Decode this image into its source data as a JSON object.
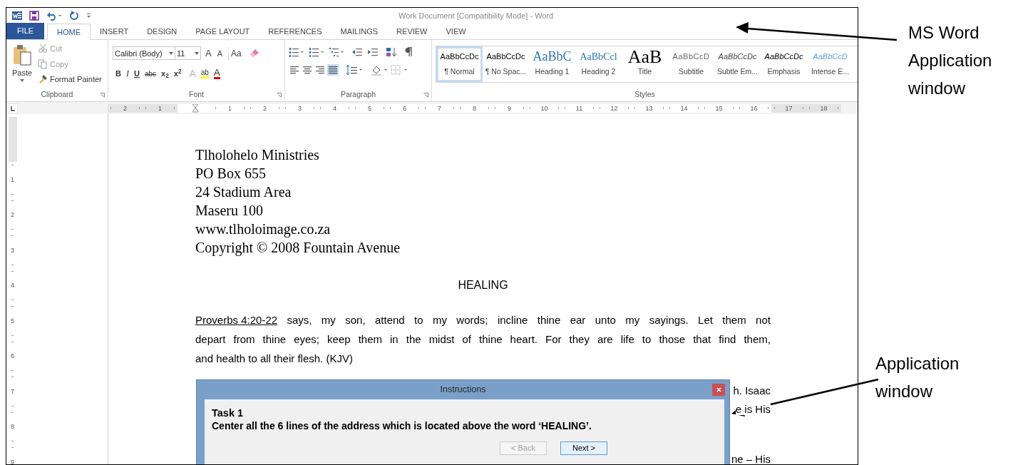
{
  "window": {
    "title": "Work Document [Compatibility Mode] - Word"
  },
  "tabs": [
    {
      "label": "FILE",
      "kind": "file",
      "selected": false
    },
    {
      "label": "HOME",
      "kind": "tab",
      "selected": true
    },
    {
      "label": "INSERT",
      "kind": "tab",
      "selected": false
    },
    {
      "label": "DESIGN",
      "kind": "tab",
      "selected": false
    },
    {
      "label": "PAGE LAYOUT",
      "kind": "tab",
      "selected": false
    },
    {
      "label": "REFERENCES",
      "kind": "tab",
      "selected": false
    },
    {
      "label": "MAILINGS",
      "kind": "tab",
      "selected": false
    },
    {
      "label": "REVIEW",
      "kind": "tab",
      "selected": false
    },
    {
      "label": "VIEW",
      "kind": "tab",
      "selected": false
    }
  ],
  "clipboard": {
    "label": "Clipboard",
    "paste": "Paste",
    "items": [
      {
        "label": "Cut",
        "kind": "cut",
        "disabled": true
      },
      {
        "label": "Copy",
        "kind": "copy",
        "disabled": true
      },
      {
        "label": "Format Painter",
        "kind": "painter",
        "disabled": false
      }
    ]
  },
  "font": {
    "label": "Font",
    "font_name": "Calibri (Body)",
    "font_size": "11",
    "row1": [
      {
        "label": "A",
        "kind": "grow"
      },
      {
        "label": "A",
        "kind": "shrink"
      },
      {
        "label": "Aa",
        "kind": "case"
      }
    ],
    "row2": [
      {
        "label": "B",
        "kind": "bold"
      },
      {
        "label": "I",
        "kind": "italic"
      },
      {
        "label": "U",
        "kind": "underline"
      },
      {
        "label": "abc",
        "kind": "strike"
      },
      {
        "label": "x$_{2}$",
        "kind": "sub"
      },
      {
        "label": "x$^{2}$",
        "kind": "sup"
      },
      {
        "label": "A",
        "kind": "effects"
      },
      {
        "label": "ab",
        "kind": "highlight"
      },
      {
        "label": "A",
        "kind": "color"
      }
    ]
  },
  "paragraph": {
    "label": "Paragraph",
    "alignments": [
      {
        "kind": "left",
        "selected": false
      },
      {
        "kind": "center",
        "selected": false
      },
      {
        "kind": "right",
        "selected": false
      },
      {
        "kind": "justify",
        "selected": true
      }
    ]
  },
  "styles": {
    "label": "Styles",
    "items": [
      {
        "preview": "AaBbCcDc",
        "label": "¶ Normal",
        "kind": "normal",
        "selected": true
      },
      {
        "preview": "AaBbCcDc",
        "label": "¶ No Spac...",
        "kind": "normal",
        "selected": false
      },
      {
        "preview": "AaBbC",
        "label": "Heading 1",
        "kind": "heading1",
        "selected": false
      },
      {
        "preview": "AaBbCcl",
        "label": "Heading 2",
        "kind": "heading2",
        "selected": false
      },
      {
        "preview": "AaB",
        "label": "Title",
        "kind": "title",
        "selected": false
      },
      {
        "preview": "AaBbCcD",
        "label": "Subtitle",
        "kind": "subtitle",
        "selected": false
      },
      {
        "preview": "AaBbCcDc",
        "label": "Subtle Em...",
        "kind": "subtle",
        "selected": false
      },
      {
        "preview": "AaBbCcDc",
        "label": "Emphasis",
        "kind": "emphasis",
        "selected": false
      },
      {
        "preview": "AaBbCcD",
        "label": "Intense E...",
        "kind": "intense",
        "selected": false
      }
    ]
  },
  "ruler": {
    "horizontal": [
      "2",
      "1",
      "1",
      "2",
      "3",
      "4",
      "5",
      "6",
      "7",
      "8",
      "9",
      "10",
      "11",
      "12",
      "13",
      "14",
      "15",
      "16",
      "17",
      "18"
    ],
    "vertical": [
      "1",
      "2",
      "3",
      "4",
      "5",
      "6",
      "7",
      "8",
      "9"
    ]
  },
  "document": {
    "address": [
      "Tlholohelo Ministries",
      "PO Box 655",
      "24 Stadium Area",
      "Maseru 100",
      "www.tlholoimage.co.za",
      "Copyright © 2008 Fountain Avenue"
    ],
    "heading": "HEALING",
    "paragraph": {
      "reference": "Proverbs 4:20-22",
      "lines": [
        "says, my son, attend to my words; incline thine ear unto my sayings. Let them not",
        "depart from thine eyes; keep them in the midst of thine heart. For they are life to those that find them,",
        "and health to all their flesh. (KJV)"
      ]
    },
    "partial_text": [
      "h. Isaac",
      "e is His",
      "ne – His"
    ]
  },
  "dialog": {
    "title": "Instructions",
    "task_title": "Task 1",
    "instruction": "Center all the 6 lines of the address which is located above the word ‘HEALING’.",
    "buttons": [
      {
        "label": "< Back",
        "disabled": true
      },
      {
        "label": "Next >",
        "disabled": false
      }
    ]
  },
  "annotations": [
    {
      "lines": [
        "MS Word",
        "Application",
        "window"
      ]
    },
    {
      "lines": [
        "Application",
        "window"
      ]
    }
  ]
}
